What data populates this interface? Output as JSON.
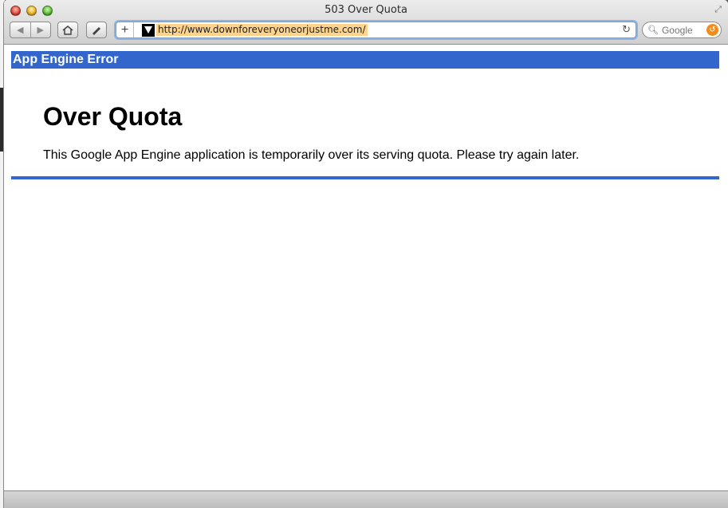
{
  "window": {
    "title": "503 Over Quota"
  },
  "toolbar": {
    "url": "http://www.downforeveryoneorjustme.com/",
    "search_placeholder": "Google",
    "add_button": "+"
  },
  "page": {
    "header": "App Engine Error",
    "heading": "Over Quota",
    "message": "This Google App Engine application is temporarily over its serving quota. Please try again later."
  },
  "colors": {
    "accent": "#3366cc",
    "url_highlight": "#ffd48a"
  }
}
